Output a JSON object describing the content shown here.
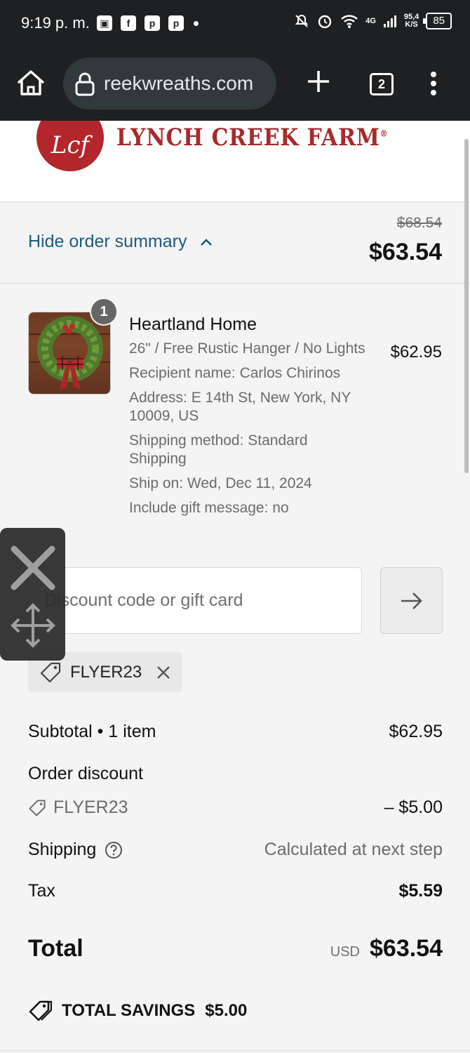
{
  "status_bar": {
    "time": "9:19 p. m.",
    "network": "4G",
    "speed_value": "95,4",
    "speed_unit": "K/S",
    "battery": "85"
  },
  "browser": {
    "url": "reekwreaths.com",
    "tab_count": "2"
  },
  "site": {
    "brand_name": "LYNCH CREEK FARM",
    "registered": "®",
    "logo_initials": "Lcf"
  },
  "summary": {
    "toggle_label": "Hide order summary",
    "original_price": "$68.54",
    "current_price": "$63.54"
  },
  "product": {
    "quantity": "1",
    "name": "Heartland Home",
    "variant": "26\" / Free Rustic Hanger / No Lights",
    "recipient": "Recipient name: Carlos Chirinos",
    "address": "Address: E 14th St, New York, NY 10009, US",
    "shipping_method": "Shipping method: Standard Shipping",
    "ship_on": "Ship on: Wed, Dec 11, 2024",
    "gift_message": "Include gift message: no",
    "price": "$62.95"
  },
  "discount": {
    "placeholder": "Discount code or gift card",
    "applied_code": "FLYER23"
  },
  "totals": {
    "subtotal_label": "Subtotal • 1 item",
    "subtotal_value": "$62.95",
    "order_discount_label": "Order discount",
    "discount_code": "FLYER23",
    "discount_value": "– $5.00",
    "shipping_label": "Shipping",
    "shipping_value": "Calculated at next step",
    "tax_label": "Tax",
    "tax_value": "$5.59",
    "total_label": "Total",
    "currency": "USD",
    "total_value": "$63.54",
    "savings_label": "TOTAL SAVINGS",
    "savings_value": "$5.00"
  },
  "colors": {
    "link": "#1b5b83",
    "brand_red": "#a72a2c",
    "background": "#f4f4f4"
  }
}
